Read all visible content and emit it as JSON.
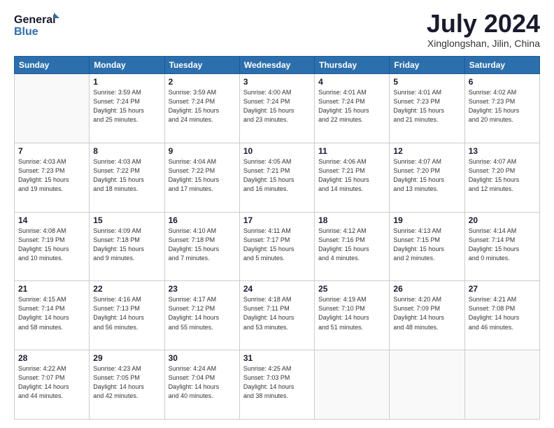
{
  "header": {
    "logo_line1": "General",
    "logo_line2": "Blue",
    "month": "July 2024",
    "location": "Xinglongshan, Jilin, China"
  },
  "days_of_week": [
    "Sunday",
    "Monday",
    "Tuesday",
    "Wednesday",
    "Thursday",
    "Friday",
    "Saturday"
  ],
  "weeks": [
    [
      {
        "day": "",
        "info": ""
      },
      {
        "day": "1",
        "info": "Sunrise: 3:59 AM\nSunset: 7:24 PM\nDaylight: 15 hours\nand 25 minutes."
      },
      {
        "day": "2",
        "info": "Sunrise: 3:59 AM\nSunset: 7:24 PM\nDaylight: 15 hours\nand 24 minutes."
      },
      {
        "day": "3",
        "info": "Sunrise: 4:00 AM\nSunset: 7:24 PM\nDaylight: 15 hours\nand 23 minutes."
      },
      {
        "day": "4",
        "info": "Sunrise: 4:01 AM\nSunset: 7:24 PM\nDaylight: 15 hours\nand 22 minutes."
      },
      {
        "day": "5",
        "info": "Sunrise: 4:01 AM\nSunset: 7:23 PM\nDaylight: 15 hours\nand 21 minutes."
      },
      {
        "day": "6",
        "info": "Sunrise: 4:02 AM\nSunset: 7:23 PM\nDaylight: 15 hours\nand 20 minutes."
      }
    ],
    [
      {
        "day": "7",
        "info": "Sunrise: 4:03 AM\nSunset: 7:23 PM\nDaylight: 15 hours\nand 19 minutes."
      },
      {
        "day": "8",
        "info": "Sunrise: 4:03 AM\nSunset: 7:22 PM\nDaylight: 15 hours\nand 18 minutes."
      },
      {
        "day": "9",
        "info": "Sunrise: 4:04 AM\nSunset: 7:22 PM\nDaylight: 15 hours\nand 17 minutes."
      },
      {
        "day": "10",
        "info": "Sunrise: 4:05 AM\nSunset: 7:21 PM\nDaylight: 15 hours\nand 16 minutes."
      },
      {
        "day": "11",
        "info": "Sunrise: 4:06 AM\nSunset: 7:21 PM\nDaylight: 15 hours\nand 14 minutes."
      },
      {
        "day": "12",
        "info": "Sunrise: 4:07 AM\nSunset: 7:20 PM\nDaylight: 15 hours\nand 13 minutes."
      },
      {
        "day": "13",
        "info": "Sunrise: 4:07 AM\nSunset: 7:20 PM\nDaylight: 15 hours\nand 12 minutes."
      }
    ],
    [
      {
        "day": "14",
        "info": "Sunrise: 4:08 AM\nSunset: 7:19 PM\nDaylight: 15 hours\nand 10 minutes."
      },
      {
        "day": "15",
        "info": "Sunrise: 4:09 AM\nSunset: 7:18 PM\nDaylight: 15 hours\nand 9 minutes."
      },
      {
        "day": "16",
        "info": "Sunrise: 4:10 AM\nSunset: 7:18 PM\nDaylight: 15 hours\nand 7 minutes."
      },
      {
        "day": "17",
        "info": "Sunrise: 4:11 AM\nSunset: 7:17 PM\nDaylight: 15 hours\nand 5 minutes."
      },
      {
        "day": "18",
        "info": "Sunrise: 4:12 AM\nSunset: 7:16 PM\nDaylight: 15 hours\nand 4 minutes."
      },
      {
        "day": "19",
        "info": "Sunrise: 4:13 AM\nSunset: 7:15 PM\nDaylight: 15 hours\nand 2 minutes."
      },
      {
        "day": "20",
        "info": "Sunrise: 4:14 AM\nSunset: 7:14 PM\nDaylight: 15 hours\nand 0 minutes."
      }
    ],
    [
      {
        "day": "21",
        "info": "Sunrise: 4:15 AM\nSunset: 7:14 PM\nDaylight: 14 hours\nand 58 minutes."
      },
      {
        "day": "22",
        "info": "Sunrise: 4:16 AM\nSunset: 7:13 PM\nDaylight: 14 hours\nand 56 minutes."
      },
      {
        "day": "23",
        "info": "Sunrise: 4:17 AM\nSunset: 7:12 PM\nDaylight: 14 hours\nand 55 minutes."
      },
      {
        "day": "24",
        "info": "Sunrise: 4:18 AM\nSunset: 7:11 PM\nDaylight: 14 hours\nand 53 minutes."
      },
      {
        "day": "25",
        "info": "Sunrise: 4:19 AM\nSunset: 7:10 PM\nDaylight: 14 hours\nand 51 minutes."
      },
      {
        "day": "26",
        "info": "Sunrise: 4:20 AM\nSunset: 7:09 PM\nDaylight: 14 hours\nand 48 minutes."
      },
      {
        "day": "27",
        "info": "Sunrise: 4:21 AM\nSunset: 7:08 PM\nDaylight: 14 hours\nand 46 minutes."
      }
    ],
    [
      {
        "day": "28",
        "info": "Sunrise: 4:22 AM\nSunset: 7:07 PM\nDaylight: 14 hours\nand 44 minutes."
      },
      {
        "day": "29",
        "info": "Sunrise: 4:23 AM\nSunset: 7:05 PM\nDaylight: 14 hours\nand 42 minutes."
      },
      {
        "day": "30",
        "info": "Sunrise: 4:24 AM\nSunset: 7:04 PM\nDaylight: 14 hours\nand 40 minutes."
      },
      {
        "day": "31",
        "info": "Sunrise: 4:25 AM\nSunset: 7:03 PM\nDaylight: 14 hours\nand 38 minutes."
      },
      {
        "day": "",
        "info": ""
      },
      {
        "day": "",
        "info": ""
      },
      {
        "day": "",
        "info": ""
      }
    ]
  ]
}
